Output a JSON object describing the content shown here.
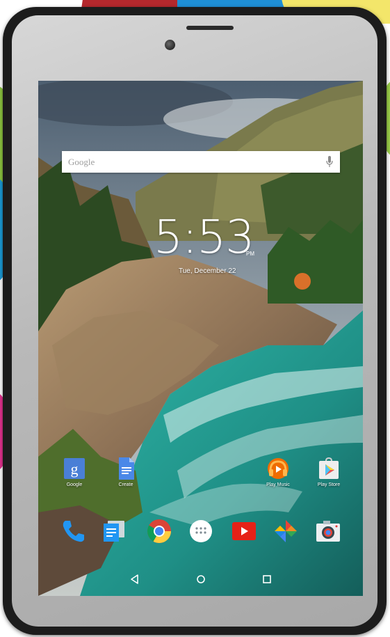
{
  "search": {
    "placeholder": "Google",
    "mic_icon": "mic-icon"
  },
  "clock": {
    "time": "5:53",
    "ampm": "PM",
    "date": "Tue, December 22"
  },
  "home_shortcuts": [
    {
      "label": "Google",
      "icon": "google-folder-icon"
    },
    {
      "label": "Create",
      "icon": "docs-icon"
    },
    {
      "label": "Play Music",
      "icon": "play-music-icon"
    },
    {
      "label": "Play Store",
      "icon": "play-store-icon"
    }
  ],
  "dock": [
    {
      "icon": "phone-icon"
    },
    {
      "icon": "messages-icon"
    },
    {
      "icon": "chrome-icon"
    },
    {
      "icon": "app-drawer-icon"
    },
    {
      "icon": "youtube-icon"
    },
    {
      "icon": "photos-icon"
    },
    {
      "icon": "camera-icon"
    }
  ],
  "navigation": [
    {
      "icon": "back-icon"
    },
    {
      "icon": "home-icon"
    },
    {
      "icon": "recents-icon"
    }
  ],
  "colors": {
    "device_bezel": "#b9b9b9",
    "device_rim": "#1c1c1c",
    "text": "#ffffff"
  }
}
